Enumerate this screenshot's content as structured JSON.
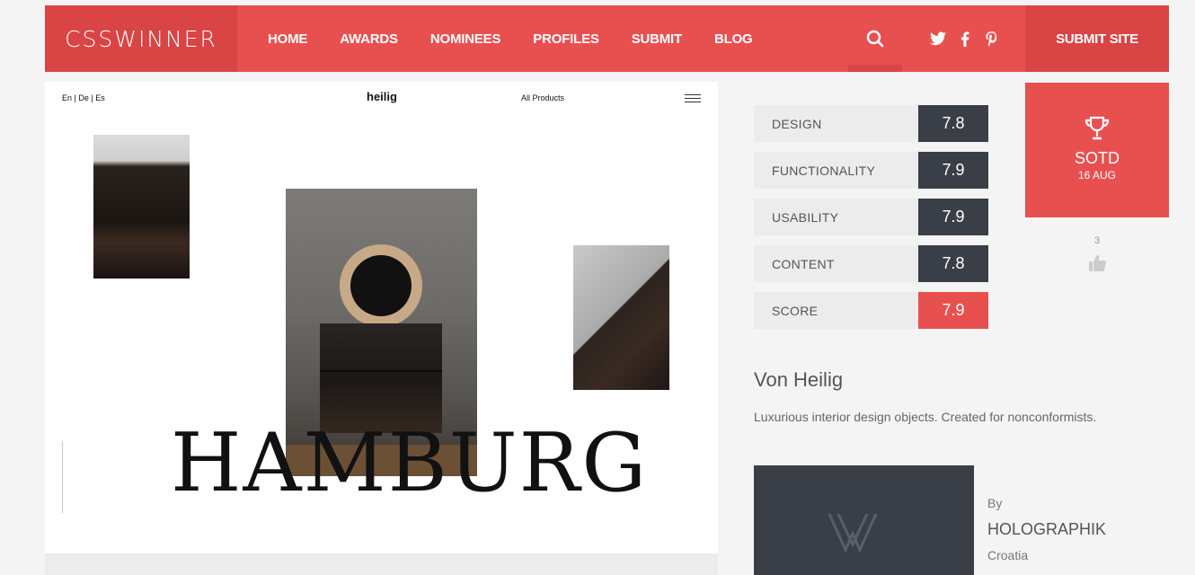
{
  "logo": "CSSWINNER",
  "nav": {
    "items": [
      "HOME",
      "AWARDS",
      "NOMINEES",
      "PROFILES",
      "SUBMIT",
      "BLOG"
    ],
    "submit_site": "SUBMIT SITE",
    "search_icon": "search-icon",
    "social": [
      "twitter-icon",
      "facebook-icon",
      "pinterest-icon"
    ]
  },
  "preview": {
    "lang": "En | De | Es",
    "brand": "heilig",
    "products": "All Products",
    "headline": "HAMBURG"
  },
  "scores": [
    {
      "label": "DESIGN",
      "value": "7.8"
    },
    {
      "label": "FUNCTIONALITY",
      "value": "7.9"
    },
    {
      "label": "USABILITY",
      "value": "7.9"
    },
    {
      "label": "CONTENT",
      "value": "7.8"
    },
    {
      "label": "SCORE",
      "value": "7.9"
    }
  ],
  "sotd": {
    "title": "SOTD",
    "date": "16 AUG"
  },
  "likes": "3",
  "site": {
    "title": "Von Heilig",
    "description": "Luxurious interior design objects. Created for nonconformists."
  },
  "author": {
    "by": "By",
    "name": "HOLOGRAPHIK",
    "country": "Croatia"
  },
  "colors": {
    "accent": "#e85050",
    "accent_dark": "#d94444",
    "dark": "#3a3e46"
  }
}
